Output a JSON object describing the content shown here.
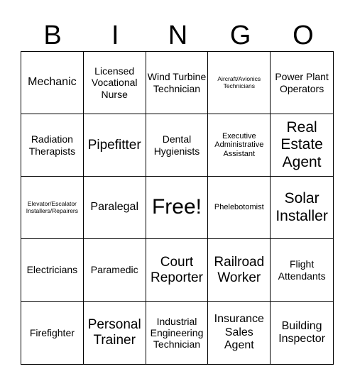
{
  "header": {
    "letters": [
      "B",
      "I",
      "N",
      "G",
      "O"
    ]
  },
  "cells": [
    {
      "text": "Mechanic",
      "size": "lg"
    },
    {
      "text": "Licensed Vocational Nurse",
      "size": "md"
    },
    {
      "text": "Wind Turbine Technician",
      "size": "md"
    },
    {
      "text": "Aircraft/Avionics Technicians",
      "size": "xs"
    },
    {
      "text": "Power Plant Operators",
      "size": "md"
    },
    {
      "text": "Radiation Therapists",
      "size": "md"
    },
    {
      "text": "Pipefitter",
      "size": "xl"
    },
    {
      "text": "Dental Hygienists",
      "size": "md"
    },
    {
      "text": "Executive Administrative Assistant",
      "size": "sm"
    },
    {
      "text": "Real Estate Agent",
      "size": "xxl"
    },
    {
      "text": "Elevator/Escalator Installers/Repairers",
      "size": "xs"
    },
    {
      "text": "Paralegal",
      "size": "lg"
    },
    {
      "text": "Free!",
      "size": "free"
    },
    {
      "text": "Phelebotomist",
      "size": "sm"
    },
    {
      "text": "Solar Installer",
      "size": "xxl"
    },
    {
      "text": "Electricians",
      "size": "md"
    },
    {
      "text": "Paramedic",
      "size": "md"
    },
    {
      "text": "Court Reporter",
      "size": "xl"
    },
    {
      "text": "Railroad Worker",
      "size": "xl"
    },
    {
      "text": "Flight Attendants",
      "size": "md"
    },
    {
      "text": "Firefighter",
      "size": "md"
    },
    {
      "text": "Personal Trainer",
      "size": "xl"
    },
    {
      "text": "Industrial Engineering Technician",
      "size": "md"
    },
    {
      "text": "Insurance Sales Agent",
      "size": "lg"
    },
    {
      "text": "Building Inspector",
      "size": "lg"
    }
  ]
}
